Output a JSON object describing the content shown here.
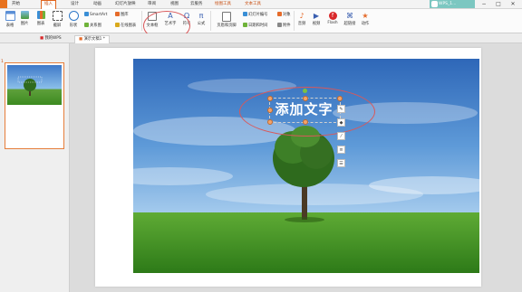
{
  "app_button_label": "",
  "menu_tabs": [
    {
      "label": "开始",
      "active": false
    },
    {
      "label": "插入",
      "active": true
    },
    {
      "label": "设计",
      "active": false
    },
    {
      "label": "动画",
      "active": false
    },
    {
      "label": "幻灯片放映",
      "active": false
    },
    {
      "label": "审阅",
      "active": false
    },
    {
      "label": "视图",
      "active": false
    },
    {
      "label": "云服务",
      "active": false
    },
    {
      "label": "绘图工具",
      "active": false
    },
    {
      "label": "文本工具",
      "active": false
    }
  ],
  "doc_title": "WPS_1...",
  "window_controls": [
    "−",
    "□",
    "✕"
  ],
  "ribbon": {
    "big_buttons": [
      "表格",
      "图片",
      "图表",
      "截屏",
      "形状"
    ],
    "smartart": "SmartArt",
    "icon_lib": "图库",
    "relation": "关系图",
    "online_pic": "在线图表",
    "textbox": "文本框",
    "wordart": "艺术字",
    "symbol": "符号",
    "formula": "公式",
    "header_footer": "页眉和页脚",
    "slide_number": "幻灯片编号",
    "datetime": "日期和时间",
    "object": "对象",
    "attachment": "附件",
    "audio": "音频",
    "video": "视频",
    "flash": "Flash",
    "hyperlink": "超链接",
    "action": "动作"
  },
  "doc_tabs": [
    {
      "label": "我的WPS",
      "active": false
    },
    {
      "label": "演示文稿1 *",
      "active": true
    }
  ],
  "slides_panel": {
    "slide_number": "1"
  },
  "slide": {
    "textbox_text": "添加文字"
  },
  "float_tools": [
    "✎",
    "◆",
    "⁄",
    "≡",
    "☰"
  ],
  "colors": {
    "accent_orange": "#e2641c",
    "annotation_red": "#d9585a",
    "sky_blue": "#3b78c6",
    "grass_green": "#3f8f24"
  }
}
